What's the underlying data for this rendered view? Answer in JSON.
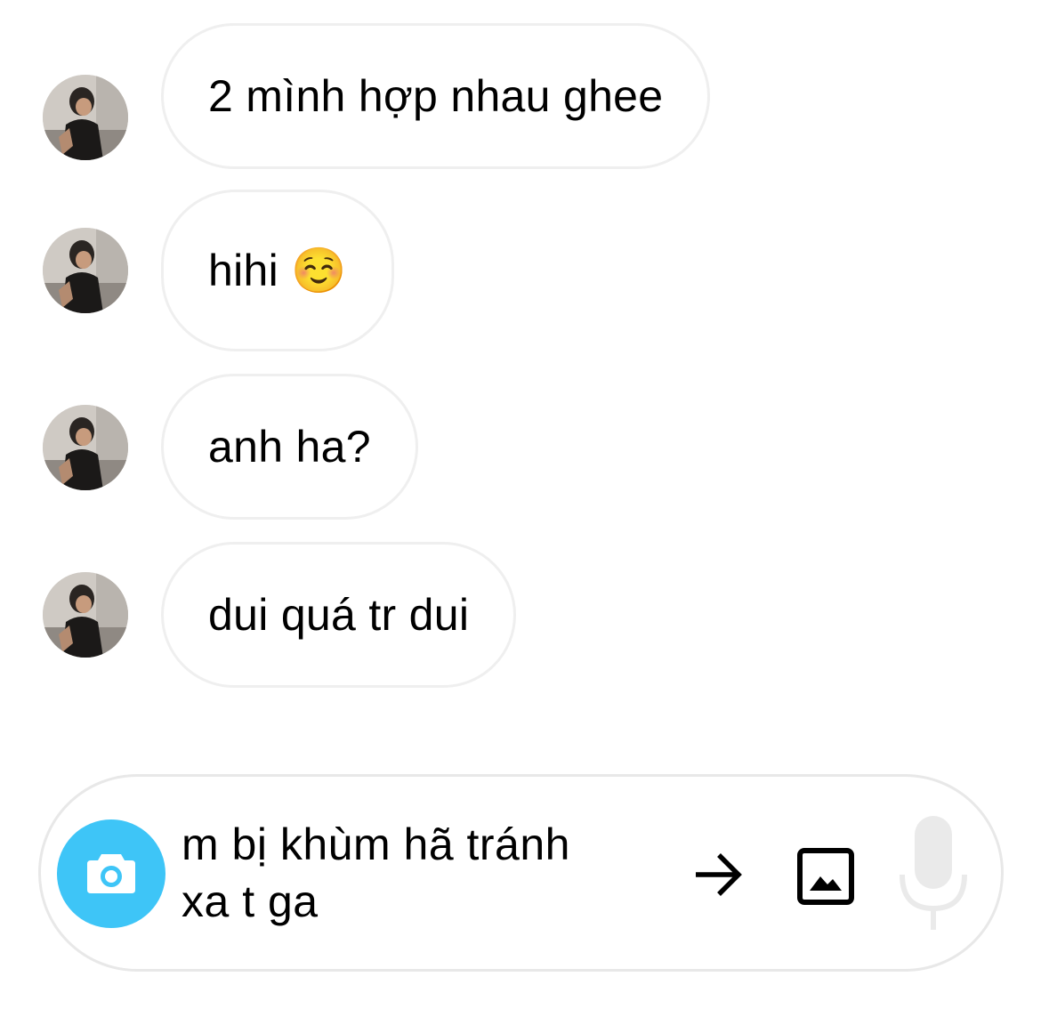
{
  "messages": [
    {
      "text": "2 mình hợp nhau ghee"
    },
    {
      "text": "hihi ☺️"
    },
    {
      "text": "anh ha?"
    },
    {
      "text": "dui quá tr dui"
    }
  ],
  "composer": {
    "input_text": "m bị khùm hã tránh\nxa t ga",
    "camera_icon": "camera-icon",
    "send_icon": "arrow-right-icon",
    "gallery_icon": "image-icon",
    "accent_color": "#3ec5f7"
  }
}
